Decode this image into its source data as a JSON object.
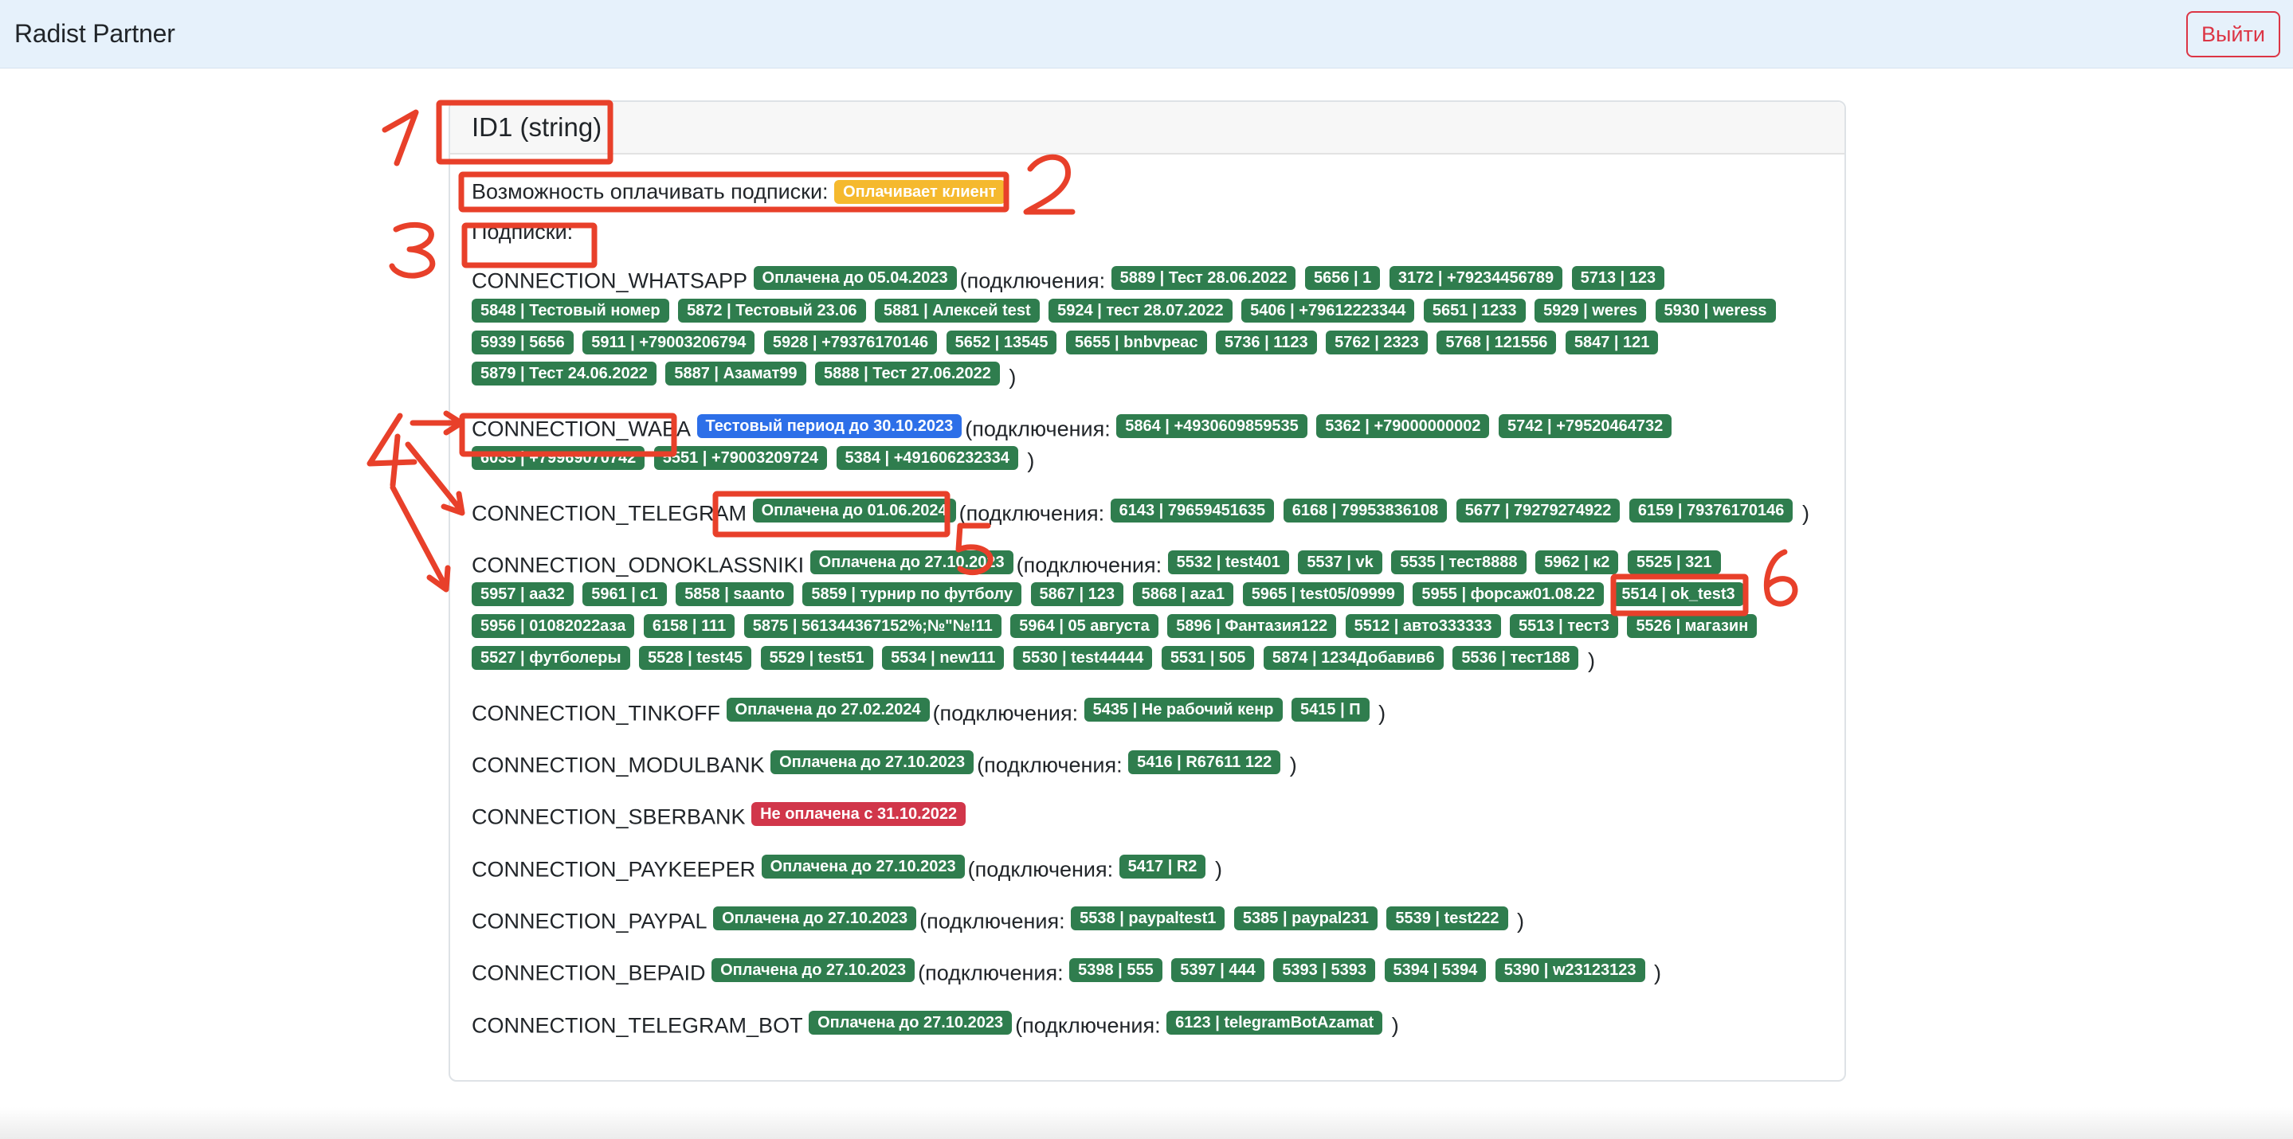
{
  "navbar": {
    "brand": "Radist Partner",
    "logout_label": "Выйти"
  },
  "card": {
    "title": "ID1 (string)",
    "payment_label": "Возможность оплачивать подписки:",
    "payment_badge": "Оплачивает клиент",
    "subscriptions_label": "Подписки:",
    "connections_open": "(подключения:",
    "connections_close": ")"
  },
  "subscriptions": [
    {
      "name": "CONNECTION_WHATSAPP",
      "status": "Оплачена до 05.04.2023",
      "status_color": "green",
      "connections": [
        "5889 | Тест 28.06.2022",
        "5656 | 1",
        "3172 | +79234456789",
        "5713 | 123",
        "5848 | Тестовый номер",
        "5872 | Тестовый 23.06",
        "5881 | Алексей test",
        "5924 | тест 28.07.2022",
        "5406 | +79612223344",
        "5651 | 1233",
        "5929 | weres",
        "5930 | weress",
        "5939 | 5656",
        "5911 | +79003206794",
        "5928 | +79376170146",
        "5652 | 13545",
        "5655 | bnbvpeac",
        "5736 | 1123",
        "5762 | 2323",
        "5768 | 121556",
        "5847 | 121",
        "5879 | Тест 24.06.2022",
        "5887 | Азамат99",
        "5888 | Тест 27.06.2022"
      ]
    },
    {
      "name": "CONNECTION_WABA",
      "status": "Тестовый период до 30.10.2023",
      "status_color": "blue",
      "connections": [
        "5864 | +4930609859535",
        "5362 | +79000000002",
        "5742 | +79520464732",
        "6035 | +79969070742",
        "5551 | +79003209724",
        "5384 | +491606232334"
      ]
    },
    {
      "name": "CONNECTION_TELEGRAM",
      "status": "Оплачена до 01.06.2024",
      "status_color": "green",
      "connections": [
        "6143 | 79659451635",
        "6168 | 79953836108",
        "5677 | 79279274922",
        "6159 | 79376170146"
      ]
    },
    {
      "name": "CONNECTION_ODNOKLASSNIKI",
      "status": "Оплачена до 27.10.2023",
      "status_color": "green",
      "connections": [
        "5532 | test401",
        "5537 | vk",
        "5535 | тест8888",
        "5962 | к2",
        "5525 | 321",
        "5957 | aa32",
        "5961 | c1",
        "5858 | saanto",
        "5859 | турнир по футболу",
        "5867 | 123",
        "5868 | aza1",
        "5965 | test05/09999",
        "5955 | форсаж01.08.22",
        "5514 | ok_test3",
        "5956 | 01082022аза",
        "6158 | 111",
        "5875 | 561344367152%;№\"№!11",
        "5964 | 05 августа",
        "5896 | Фантазия122",
        "5512 | авто333333",
        "5513 | тест3",
        "5526 | магазин",
        "5527 | футболеры",
        "5528 | test45",
        "5529 | test51",
        "5534 | new111",
        "5530 | test44444",
        "5531 | 505",
        "5874 | 1234Добавив6",
        "5536 | тест188"
      ]
    },
    {
      "name": "CONNECTION_TINKOFF",
      "status": "Оплачена до 27.02.2024",
      "status_color": "green",
      "connections": [
        "5435 | Не рабочий кенр",
        "5415 | П"
      ]
    },
    {
      "name": "CONNECTION_MODULBANK",
      "status": "Оплачена до 27.10.2023",
      "status_color": "green",
      "connections": [
        "5416 | R67611 122"
      ]
    },
    {
      "name": "CONNECTION_SBERBANK",
      "status": "Не оплачена с 31.10.2022",
      "status_color": "red",
      "connections": []
    },
    {
      "name": "CONNECTION_PAYKEEPER",
      "status": "Оплачена до 27.10.2023",
      "status_color": "green",
      "connections": [
        "5417 | R2"
      ]
    },
    {
      "name": "CONNECTION_PAYPAL",
      "status": "Оплачена до 27.10.2023",
      "status_color": "green",
      "connections": [
        "5538 | paypaltest1",
        "5385 | paypal231",
        "5539 | test222"
      ]
    },
    {
      "name": "CONNECTION_BEPAID",
      "status": "Оплачена до 27.10.2023",
      "status_color": "green",
      "connections": [
        "5398 | 555",
        "5397 | 444",
        "5393 | 5393",
        "5394 | 5394",
        "5390 | w23123123"
      ]
    },
    {
      "name": "CONNECTION_TELEGRAM_BOT",
      "status": "Оплачена до 27.10.2023",
      "status_color": "green",
      "connections": [
        "6123 | telegramBotAzamat"
      ]
    }
  ],
  "annotations": [
    "1",
    "2",
    "3",
    "4",
    "5",
    "6"
  ],
  "colors": {
    "accent_annotation": "#e8402a",
    "badge_green": "#2f7d4e",
    "badge_blue": "#2d6fe8",
    "badge_red": "#d1364a",
    "badge_yellow": "#f5b92e",
    "navbar_bg": "#e6f1fb"
  }
}
